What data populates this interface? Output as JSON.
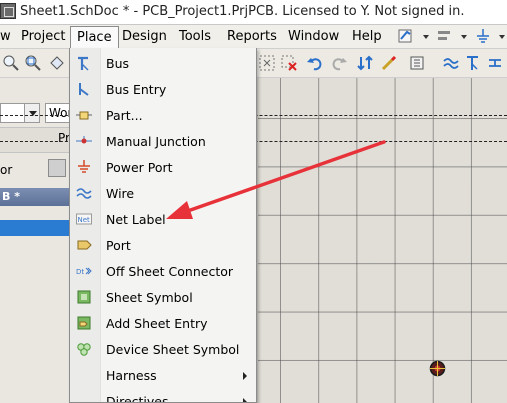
{
  "window": {
    "title": "Sheet1.SchDoc * - PCB_Project1.PrjPCB. Licensed to Y. Not signed in."
  },
  "menubar": {
    "items": [
      {
        "label": "w"
      },
      {
        "label": "Project"
      },
      {
        "label": "Place"
      },
      {
        "label": "Design"
      },
      {
        "label": "Tools"
      },
      {
        "label": "Reports"
      },
      {
        "label": "Window"
      },
      {
        "label": "Help"
      }
    ],
    "active": "Place"
  },
  "left_panel": {
    "workspace_field": "Wor",
    "project_row_label": "Pr",
    "panel_label": "or",
    "document_header": "B *"
  },
  "place_menu": {
    "items": [
      {
        "label": "Bus",
        "icon": "bus-icon"
      },
      {
        "label": "Bus Entry",
        "icon": "bus-entry-icon"
      },
      {
        "label": "Part...",
        "icon": "part-icon"
      },
      {
        "label": "Manual Junction",
        "icon": "junction-icon"
      },
      {
        "label": "Power Port",
        "icon": "power-port-icon"
      },
      {
        "label": "Wire",
        "icon": "wire-icon"
      },
      {
        "label": "Net Label",
        "icon": "net-label-icon",
        "icon_text": "Net"
      },
      {
        "label": "Port",
        "icon": "port-icon"
      },
      {
        "label": "Off Sheet Connector",
        "icon": "off-sheet-connector-icon",
        "icon_text": "Dt"
      },
      {
        "label": "Sheet Symbol",
        "icon": "sheet-symbol-icon"
      },
      {
        "label": "Add Sheet Entry",
        "icon": "sheet-entry-icon"
      },
      {
        "label": "Device Sheet Symbol",
        "icon": "device-sheet-symbol-icon"
      },
      {
        "label": "Harness",
        "icon": "",
        "submenu": true
      },
      {
        "label": "Directives",
        "icon": "",
        "submenu": true
      }
    ]
  },
  "colors": {
    "accent_selection": "#2a7bd2",
    "annotation_arrow": "#e8323a",
    "menu_icon_blue": "#3d78c8",
    "power_port_red": "#d54a2a"
  }
}
